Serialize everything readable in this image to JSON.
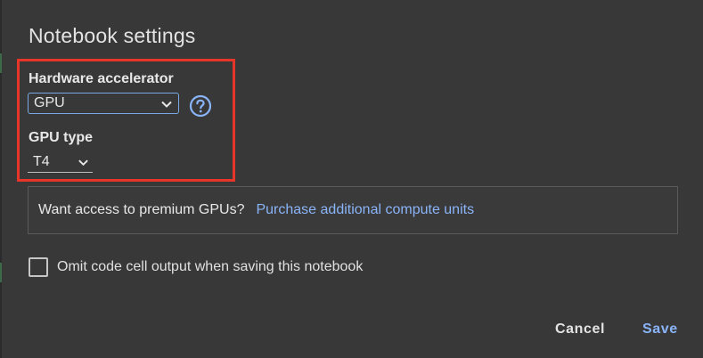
{
  "dialog": {
    "title": "Notebook settings",
    "hardware_accelerator": {
      "label": "Hardware accelerator",
      "selected": "GPU"
    },
    "gpu_type": {
      "label": "GPU type",
      "selected": "T4"
    },
    "promo": {
      "text": "Want access to premium GPUs?",
      "link": "Purchase additional compute units"
    },
    "omit_output": {
      "label": "Omit code cell output when saving this notebook",
      "checked": false
    },
    "buttons": {
      "cancel": "Cancel",
      "save": "Save"
    }
  },
  "colors": {
    "background": "#383838",
    "accent": "#8ab4f8",
    "highlight": "#e8352a"
  },
  "icons": {
    "help": "help-circle-icon",
    "dropdown": "chevron-down-icon"
  }
}
